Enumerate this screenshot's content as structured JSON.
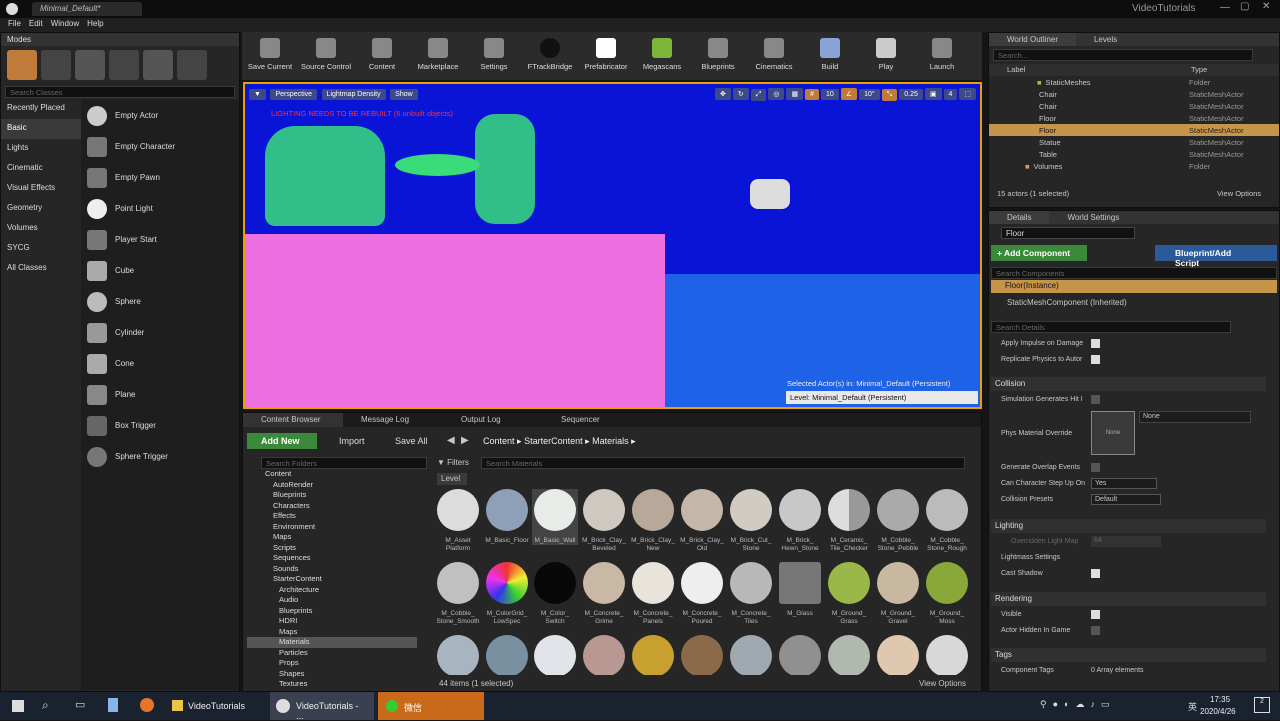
{
  "window": {
    "title": "Minimal_Default*",
    "app_title": "VideoTutorials"
  },
  "menu": [
    "File",
    "Edit",
    "Window",
    "Help"
  ],
  "modes": {
    "tab": "Modes",
    "search_placeholder": "Search Classes",
    "categories": [
      "Recently Placed",
      "Basic",
      "Lights",
      "Cinematic",
      "Visual Effects",
      "Geometry",
      "Volumes",
      "SYCG",
      "All Classes"
    ],
    "items": [
      "Empty Actor",
      "Empty Character",
      "Empty Pawn",
      "Point Light",
      "Player Start",
      "Cube",
      "Sphere",
      "Cylinder",
      "Cone",
      "Plane",
      "Box Trigger",
      "Sphere Trigger"
    ]
  },
  "toolbar": [
    {
      "label": "Save Current",
      "icon": "save-icon"
    },
    {
      "label": "Source Control",
      "icon": "source-control-icon"
    },
    {
      "label": "Content",
      "icon": "content-icon"
    },
    {
      "label": "Marketplace",
      "icon": "marketplace-icon"
    },
    {
      "label": "Settings",
      "icon": "settings-icon"
    },
    {
      "label": "FTrackBridge",
      "icon": "ftrack-icon"
    },
    {
      "label": "Prefabricator",
      "icon": "prefab-icon"
    },
    {
      "label": "Megascans",
      "icon": "megascans-icon"
    },
    {
      "label": "Blueprints",
      "icon": "blueprints-icon"
    },
    {
      "label": "Cinematics",
      "icon": "cinematics-icon"
    },
    {
      "label": "Build",
      "icon": "build-icon"
    },
    {
      "label": "Play",
      "icon": "play-icon"
    },
    {
      "label": "Launch",
      "icon": "launch-icon"
    }
  ],
  "viewport": {
    "perspective": "Perspective",
    "view_mode": "Lightmap Density",
    "show": "Show",
    "warning": "LIGHTING NEEDS TO BE REBUILT (6 unbuilt objects)",
    "selected_info": "Selected Actor(s) in:  Minimal_Default (Persistent)",
    "level_info": "Level:  Minimal_Default (Persistent)",
    "snap_grid": "10",
    "snap_rot": "10°",
    "snap_scale": "0.25",
    "cam_speed": "4"
  },
  "outliner": {
    "tab": "World Outliner",
    "tab2": "Levels",
    "search_placeholder": "Search...",
    "col_label": "Label",
    "col_type": "Type",
    "rows": [
      {
        "label": "StaticMeshes",
        "type": "Folder"
      },
      {
        "label": "Chair",
        "type": "StaticMeshActor"
      },
      {
        "label": "Chair",
        "type": "StaticMeshActor"
      },
      {
        "label": "Floor",
        "type": "StaticMeshActor"
      },
      {
        "label": "Floor",
        "type": "StaticMeshActor"
      },
      {
        "label": "Statue",
        "type": "StaticMeshActor"
      },
      {
        "label": "Table",
        "type": "StaticMeshActor"
      },
      {
        "label": "Volumes",
        "type": "Folder"
      }
    ],
    "footer": "15 actors (1 selected)",
    "view_options": "View Options"
  },
  "details": {
    "tab": "Details",
    "tab2": "World Settings",
    "name": "Floor",
    "add_component": "+ Add Component",
    "blueprint": "Blueprint/Add Script",
    "search_components": "Search Components",
    "instance": "Floor(Instance)",
    "component": "StaticMeshComponent (Inherited)",
    "search_details": "Search Details",
    "props1": [
      "Apply Impulse on Damage",
      "Replicate Physics to Autor"
    ],
    "collision": "Collision",
    "sim_hit": "Simulation Generates Hit I",
    "phys_mat": "Phys Material Override",
    "phys_none": "None",
    "phys_thumb": "None",
    "overlap": "Generate Overlap Events",
    "step_up": "Can Character Step Up On",
    "step_val": "Yes",
    "presets": "Collision Presets",
    "preset_val": "Default",
    "lighting": "Lighting",
    "override_lm": "Overridden Light Map",
    "lm_val": "64",
    "lightmass": "Lightmass Settings",
    "cast_shadow": "Cast Shadow",
    "rendering": "Rendering",
    "visible": "Visible",
    "hidden_game": "Actor Hidden In Game",
    "tags": "Tags",
    "comp_tags": "Component Tags",
    "array": "0 Array elements"
  },
  "content": {
    "tabs": [
      "Content Browser",
      "Message Log",
      "Output Log",
      "Sequencer"
    ],
    "add_new": "Add New",
    "import": "Import",
    "save_all": "Save All",
    "path": [
      "Content",
      "StarterContent",
      "Materials"
    ],
    "search_folders": "Search Folders",
    "filters": "Filters",
    "search_materials": "Search Materials",
    "level_badge": "Level",
    "folders": [
      "Content",
      "AutoRender",
      "Blueprints",
      "Characters",
      "Effects",
      "Environment",
      "Maps",
      "Scripts",
      "Sequences",
      "Sounds",
      "StarterContent",
      "Architecture",
      "Audio",
      "Blueprints",
      "HDRI",
      "Maps",
      "Materials",
      "Particles",
      "Props",
      "Shapes",
      "Textures"
    ],
    "assets": [
      "M_Asset Platform",
      "M_Basic_Floor",
      "M_Basic_Wall",
      "M_Brick_Clay_ Beveled",
      "M_Brick_Clay_ New",
      "M_Brick_Clay_ Old",
      "M_Brick_Cut_ Stone",
      "M_Brick_ Hewn_Stone",
      "M_Ceramic_ Tile_Checker",
      "M_Cobble_ Stone_Pebble",
      "M_Cobble_ Stone_Rough",
      "M_Cobble_ Stone_Smooth",
      "M_ColorGrid_ LowSpec",
      "M_Color_ Switch",
      "M_Concrete_ Grime",
      "M_Concrete_ Panels",
      "M_Concrete_ Poured",
      "M_Concrete_ Tiles",
      "M_Glass",
      "M_Ground_ Grass",
      "M_Ground_ Gravel",
      "M_Ground_ Moss"
    ],
    "count": "44 items (1 selected)",
    "view_options": "View Options"
  },
  "taskbar": {
    "items": [
      "VideoTutorials",
      "VideoTutorials - ...",
      "微信"
    ],
    "time": "17:35",
    "date": "2020/4/26",
    "lang": "英",
    "notif": "2"
  }
}
